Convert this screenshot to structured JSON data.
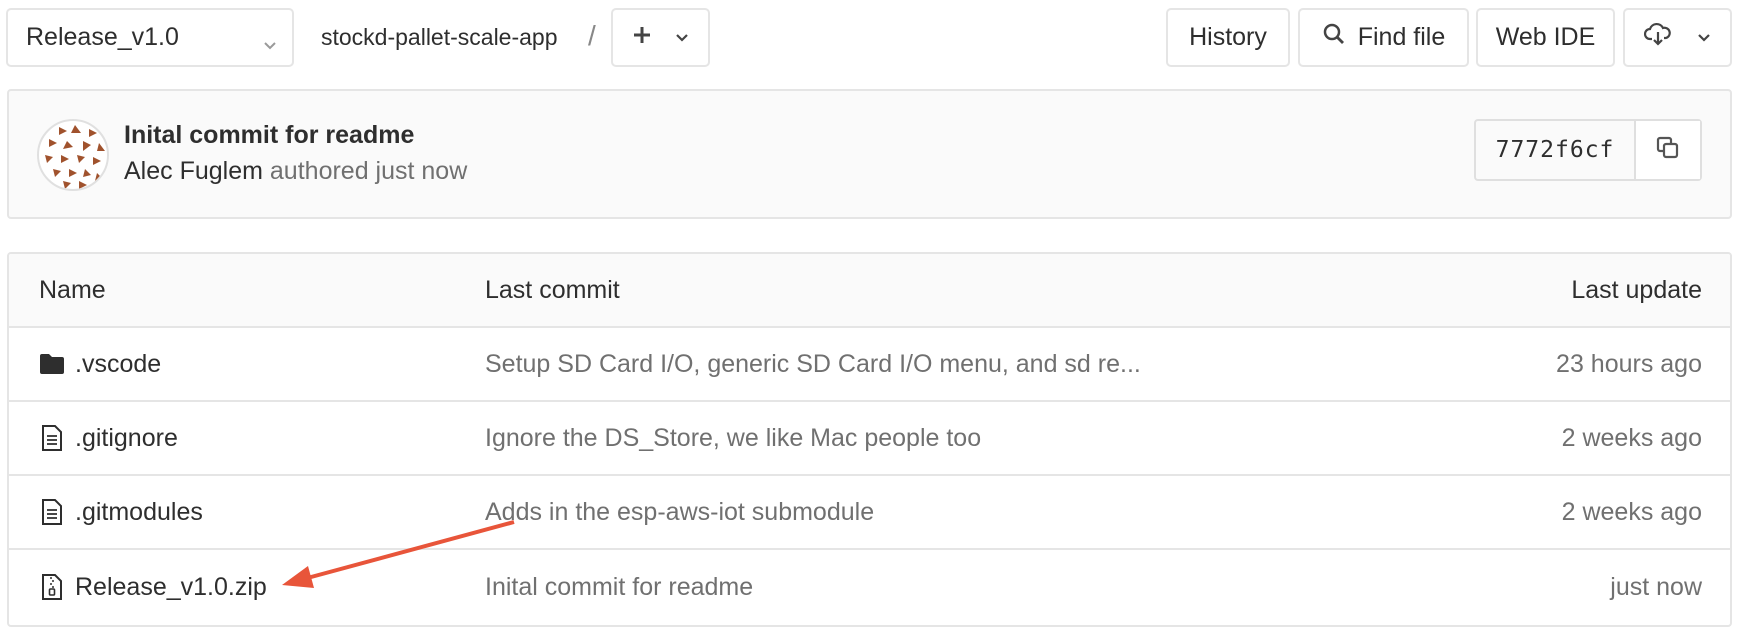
{
  "toolbar": {
    "branch": "Release_v1.0",
    "project": "stockd-pallet-scale-app",
    "separator": "/",
    "history_label": "History",
    "find_file_label": "Find file",
    "web_ide_label": "Web IDE"
  },
  "commit": {
    "title": "Inital commit for readme",
    "author": "Alec Fuglem",
    "meta": "authored just now",
    "sha": "7772f6cf"
  },
  "table": {
    "headers": {
      "name": "Name",
      "last_commit": "Last commit",
      "last_update": "Last update"
    },
    "rows": [
      {
        "name": ".vscode",
        "type": "folder-icon",
        "commit": "Setup SD Card I/O, generic SD Card I/O menu, and sd re...",
        "updated": "23 hours ago"
      },
      {
        "name": ".gitignore",
        "type": "file-icon",
        "commit": "Ignore the DS_Store, we like Mac people too",
        "updated": "2 weeks ago"
      },
      {
        "name": ".gitmodules",
        "type": "file-icon",
        "commit": "Adds in the esp-aws-iot submodule",
        "updated": "2 weeks ago"
      },
      {
        "name": "Release_v1.0.zip",
        "type": "zip-file-icon",
        "commit": "Inital commit for readme",
        "updated": "just now"
      }
    ]
  },
  "colors": {
    "annotation_arrow": "#e8553a",
    "avatar_shape": "#a0522d"
  }
}
